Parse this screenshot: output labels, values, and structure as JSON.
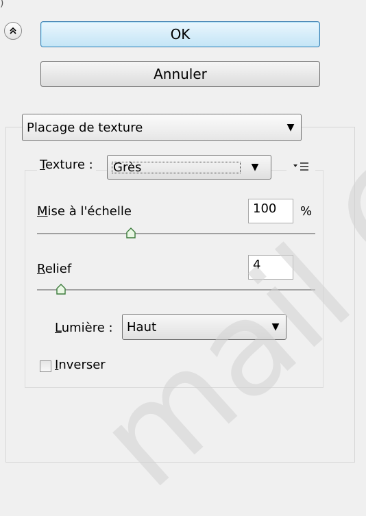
{
  "buttons": {
    "ok": "OK",
    "cancel": "Annuler"
  },
  "mode_select": {
    "value": "Placage de texture"
  },
  "texture": {
    "label_first": "T",
    "label_rest": "exture :",
    "value": "Grès"
  },
  "scale": {
    "label_first": "M",
    "label_rest": "ise à l'échelle",
    "value": "100",
    "unit": "%",
    "slider_fraction": 0.34
  },
  "relief": {
    "label_first": "R",
    "label_rest": "elief",
    "value": "4",
    "slider_fraction": 0.07
  },
  "light": {
    "label_first": "L",
    "label_rest": "umière :",
    "value": "Haut"
  },
  "invert": {
    "label_first": "I",
    "label_rest": "nverser",
    "checked": false
  },
  "watermark": "mail C"
}
